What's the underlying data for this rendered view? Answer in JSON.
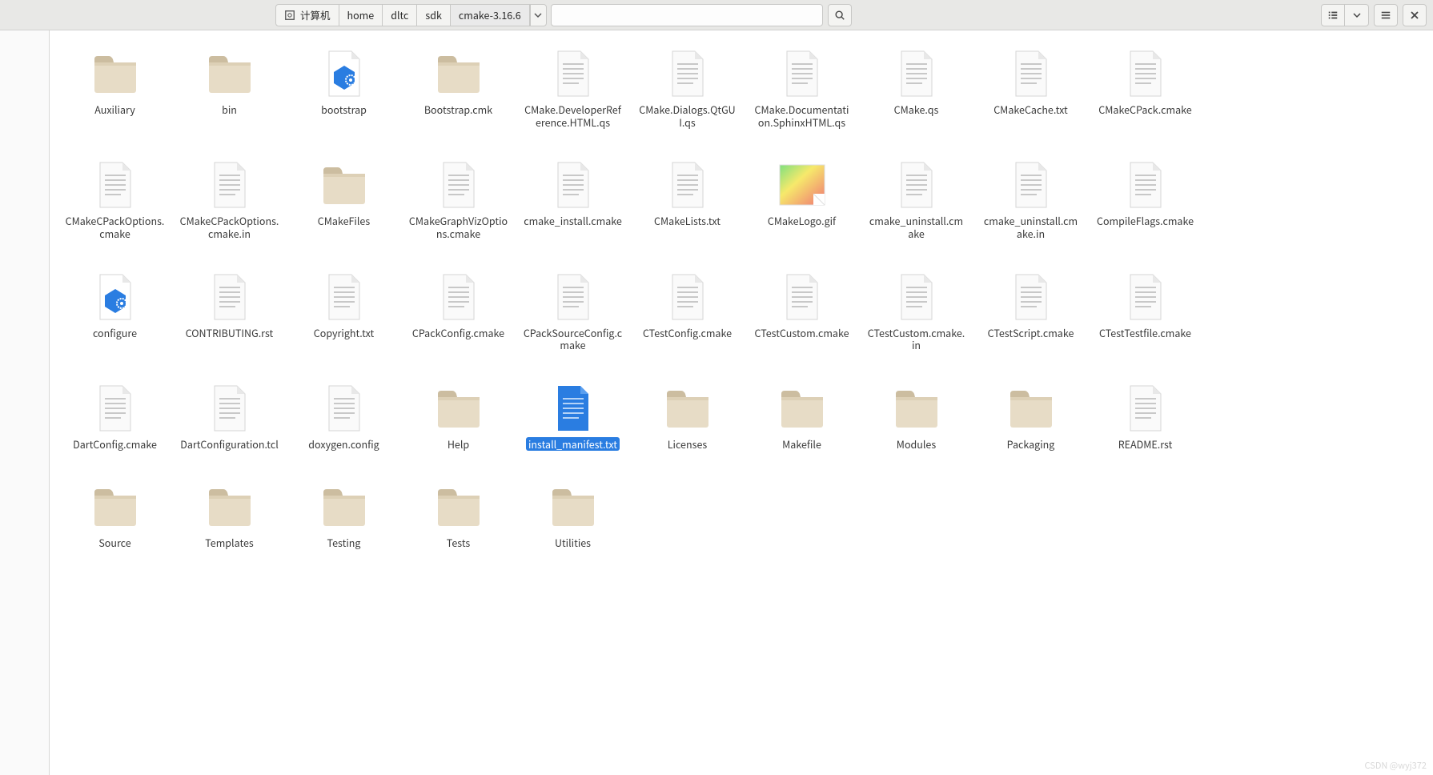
{
  "breadcrumbs": {
    "root_label": "计算机",
    "items": [
      "home",
      "dltc",
      "sdk",
      "cmake-3.16.6"
    ]
  },
  "watermark": "CSDN @wyj372",
  "search": {
    "placeholder": ""
  },
  "files": [
    {
      "name": "Auxiliary",
      "kind": "folder"
    },
    {
      "name": "bin",
      "kind": "folder"
    },
    {
      "name": "bootstrap",
      "kind": "file-gear"
    },
    {
      "name": "Bootstrap.cmk",
      "kind": "folder"
    },
    {
      "name": "CMake.DeveloperReference.HTML.qs",
      "kind": "file-text"
    },
    {
      "name": "CMake.Dialogs.QtGUI.qs",
      "kind": "file-text"
    },
    {
      "name": "CMake.Documentation.SphinxHTML.qs",
      "kind": "file-text"
    },
    {
      "name": "CMake.qs",
      "kind": "file-text"
    },
    {
      "name": "CMakeCache.txt",
      "kind": "file-text"
    },
    {
      "name": "CMakeCPack.cmake",
      "kind": "file-text"
    },
    {
      "name": "CMakeCPackOptions.cmake",
      "kind": "file-text"
    },
    {
      "name": "CMakeCPackOptions.cmake.in",
      "kind": "file-text"
    },
    {
      "name": "CMakeFiles",
      "kind": "folder"
    },
    {
      "name": "CMakeGraphVizOptions.cmake",
      "kind": "file-text"
    },
    {
      "name": "cmake_install.cmake",
      "kind": "file-text"
    },
    {
      "name": "CMakeLists.txt",
      "kind": "file-text"
    },
    {
      "name": "CMakeLogo.gif",
      "kind": "file-image"
    },
    {
      "name": "cmake_uninstall.cmake",
      "kind": "file-text"
    },
    {
      "name": "cmake_uninstall.cmake.in",
      "kind": "file-text"
    },
    {
      "name": "CompileFlags.cmake",
      "kind": "file-text"
    },
    {
      "name": "configure",
      "kind": "file-gear"
    },
    {
      "name": "CONTRIBUTING.rst",
      "kind": "file-text"
    },
    {
      "name": "Copyright.txt",
      "kind": "file-text"
    },
    {
      "name": "CPackConfig.cmake",
      "kind": "file-text"
    },
    {
      "name": "CPackSourceConfig.cmake",
      "kind": "file-text"
    },
    {
      "name": "CTestConfig.cmake",
      "kind": "file-text"
    },
    {
      "name": "CTestCustom.cmake",
      "kind": "file-text"
    },
    {
      "name": "CTestCustom.cmake.in",
      "kind": "file-text"
    },
    {
      "name": "CTestScript.cmake",
      "kind": "file-text"
    },
    {
      "name": "CTestTestfile.cmake",
      "kind": "file-text"
    },
    {
      "name": "DartConfig.cmake",
      "kind": "file-text"
    },
    {
      "name": "DartConfiguration.tcl",
      "kind": "file-text"
    },
    {
      "name": "doxygen.config",
      "kind": "file-text"
    },
    {
      "name": "Help",
      "kind": "folder"
    },
    {
      "name": "install_manifest.txt",
      "kind": "file-text-selected",
      "selected": true
    },
    {
      "name": "Licenses",
      "kind": "folder"
    },
    {
      "name": "Makefile",
      "kind": "folder"
    },
    {
      "name": "Modules",
      "kind": "folder"
    },
    {
      "name": "Packaging",
      "kind": "folder"
    },
    {
      "name": "README.rst",
      "kind": "file-text"
    },
    {
      "name": "Source",
      "kind": "folder"
    },
    {
      "name": "Templates",
      "kind": "folder"
    },
    {
      "name": "Testing",
      "kind": "folder"
    },
    {
      "name": "Tests",
      "kind": "folder"
    },
    {
      "name": "Utilities",
      "kind": "folder"
    }
  ]
}
